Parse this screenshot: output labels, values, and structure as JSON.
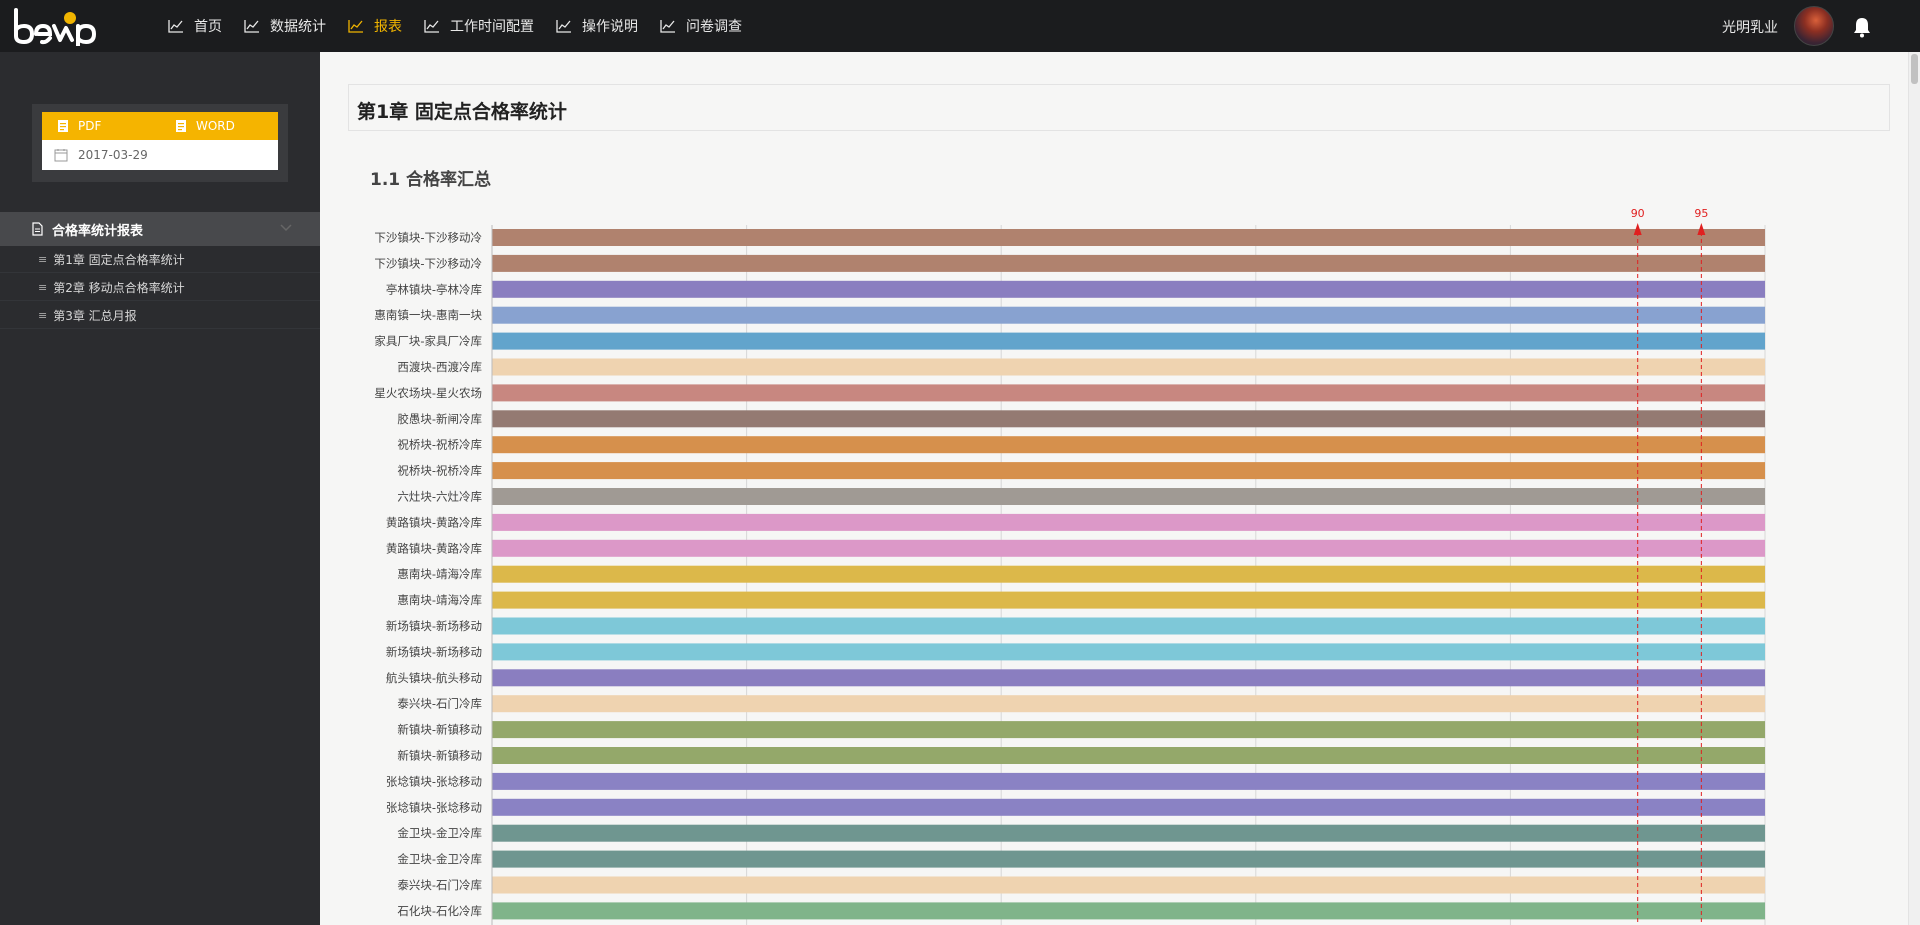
{
  "brand": {
    "logo_text": "beep"
  },
  "nav": [
    {
      "label": "首页",
      "active": false
    },
    {
      "label": "数据统计",
      "active": false
    },
    {
      "label": "报表",
      "active": true
    },
    {
      "label": "工作时间配置",
      "active": false
    },
    {
      "label": "操作说明",
      "active": false
    },
    {
      "label": "问卷调查",
      "active": false
    }
  ],
  "user": {
    "name": "光明乳业",
    "bell_icon": "bell-icon"
  },
  "sidebar": {
    "export": {
      "pdf_label": "PDF",
      "word_label": "WORD",
      "date": "2017-03-29"
    },
    "menu_title": "合格率统计报表",
    "items": [
      {
        "label": "第1章 固定点合格率统计"
      },
      {
        "label": "第2章 移动点合格率统计"
      },
      {
        "label": "第3章 汇总月报"
      }
    ]
  },
  "main": {
    "chapter_title": "第1章 固定点合格率统计",
    "section_title": "1.1 合格率汇总"
  },
  "chart_data": {
    "type": "bar",
    "orientation": "horizontal",
    "xlim": [
      0,
      100
    ],
    "grid": true,
    "reference_lines": [
      {
        "value": 90,
        "label": "90",
        "color": "#e02020"
      },
      {
        "value": 95,
        "label": "95",
        "color": "#e02020"
      }
    ],
    "categories": [
      "下沙镇块-下沙移动冷",
      "下沙镇块-下沙移动冷",
      "亭林镇块-亭林冷库",
      "惠南镇一块-惠南一块",
      "家具厂块-家具厂冷库",
      "西渡块-西渡冷库",
      "星火农场块-星火农场",
      "胶愚块-新闸冷库",
      "祝桥块-祝桥冷库",
      "祝桥块-祝桥冷库",
      "六灶块-六灶冷库",
      "黄路镇块-黄路冷库",
      "黄路镇块-黄路冷库",
      "惠南块-靖海冷库",
      "惠南块-靖海冷库",
      "新场镇块-新场移动",
      "新场镇块-新场移动",
      "航头镇块-航头移动",
      "泰兴块-石门冷库",
      "新镇块-新镇移动",
      "新镇块-新镇移动",
      "张埝镇块-张埝移动",
      "张埝镇块-张埝移动",
      "金卫块-金卫冷库",
      "金卫块-金卫冷库",
      "泰兴块-石门冷库",
      "石化块-石化冷库"
    ],
    "values": [
      100,
      100,
      100,
      100,
      100,
      100,
      100,
      100,
      100,
      100,
      100,
      100,
      100,
      100,
      100,
      100,
      100,
      100,
      100,
      100,
      100,
      100,
      100,
      100,
      100,
      100,
      100
    ],
    "colors": [
      "#b0826e",
      "#b0826e",
      "#8a7ec0",
      "#88a2d0",
      "#62a4cc",
      "#efd3b0",
      "#c88780",
      "#947a72",
      "#d6904c",
      "#d6904c",
      "#a09a94",
      "#dc98c8",
      "#dc98c8",
      "#dcb84a",
      "#dcb84a",
      "#7ec8d8",
      "#7ec8d8",
      "#8a7ec0",
      "#efd3b0",
      "#94a86a",
      "#94a86a",
      "#8a82c4",
      "#8a82c4",
      "#6f9690",
      "#6f9690",
      "#efd3b0",
      "#80b48a"
    ]
  }
}
